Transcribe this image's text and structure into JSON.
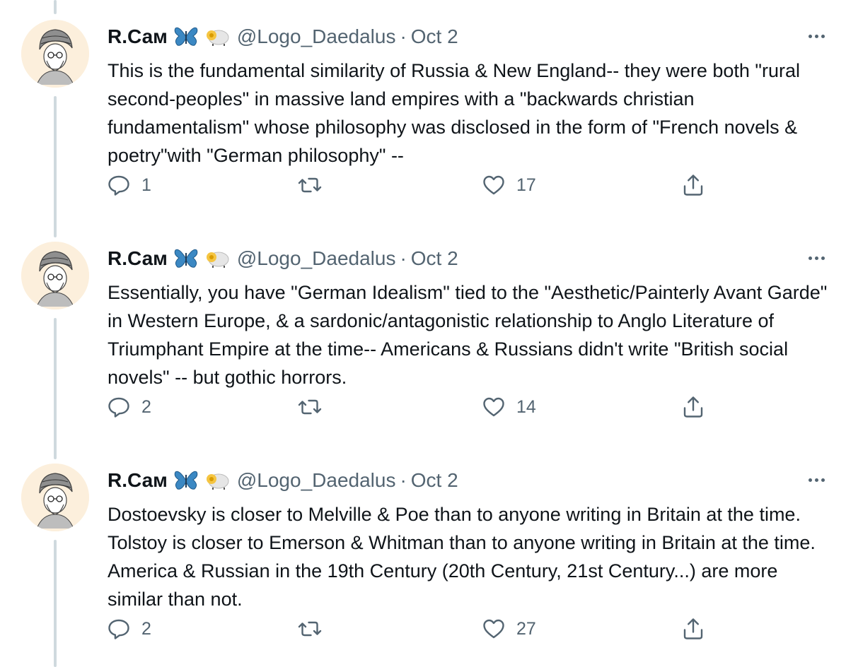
{
  "colors": {
    "text": "#0f1419",
    "secondary": "#536471",
    "thread_line": "#cfd9de"
  },
  "icons": [
    "avatar",
    "butterfly-emoji",
    "sheep-emoji",
    "more-icon",
    "reply-icon",
    "retweet-icon",
    "like-icon",
    "share-icon"
  ],
  "tweets": [
    {
      "author": {
        "name": "R.Сам",
        "handle": "@Logo_Daedalus"
      },
      "separator": "·",
      "date": "Oct 2",
      "text": "This is the fundamental similarity of Russia & New England-- they were both \"rural second-peoples\" in massive land empires with a \"backwards christian fundamentalism\" whose philosophy was disclosed in the form of \"French novels & poetry\"with \"German philosophy\" --",
      "replies": "1",
      "retweets": "",
      "likes": "17"
    },
    {
      "author": {
        "name": "R.Сам",
        "handle": "@Logo_Daedalus"
      },
      "separator": "·",
      "date": "Oct 2",
      "text": "Essentially, you have \"German Idealism\" tied to the \"Aesthetic/Painterly Avant Garde\" in Western Europe, & a sardonic/antagonistic relationship to Anglo Literature of Triumphant Empire at the time-- Americans & Russians didn't write \"British social novels\" -- but gothic horrors.",
      "replies": "2",
      "retweets": "",
      "likes": "14"
    },
    {
      "author": {
        "name": "R.Сам",
        "handle": "@Logo_Daedalus"
      },
      "separator": "·",
      "date": "Oct 2",
      "text": "Dostoevsky is closer to Melville & Poe than to anyone writing in Britain at the time. Tolstoy is closer to Emerson & Whitman than to anyone writing in Britain at the time. America & Russian in the 19th Century (20th Century, 21st Century...) are more similar than not.",
      "replies": "2",
      "retweets": "",
      "likes": "27"
    }
  ]
}
